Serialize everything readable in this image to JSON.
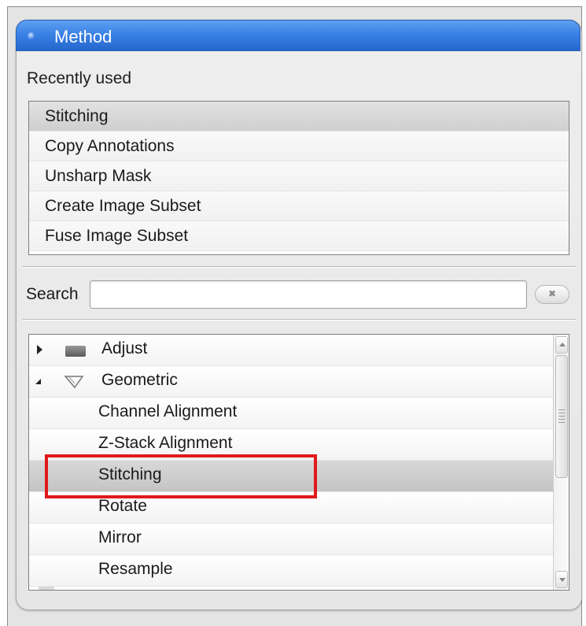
{
  "panel": {
    "title": "Method"
  },
  "recently_used": {
    "label": "Recently used",
    "items": [
      {
        "label": "Stitching",
        "selected": true
      },
      {
        "label": "Copy Annotations"
      },
      {
        "label": "Unsharp Mask"
      },
      {
        "label": "Create Image Subset"
      },
      {
        "label": "Fuse Image Subset"
      }
    ]
  },
  "search": {
    "label": "Search",
    "value": "",
    "placeholder": ""
  },
  "tree": {
    "categories": [
      {
        "label": "Adjust",
        "expanded": false,
        "icon": "folder-icon"
      },
      {
        "label": "Geometric",
        "expanded": true,
        "icon": "geometric-icon"
      }
    ],
    "items": [
      {
        "label": "Channel Alignment"
      },
      {
        "label": "Z-Stack Alignment"
      },
      {
        "label": "Stitching",
        "selected": true
      },
      {
        "label": "Rotate"
      },
      {
        "label": "Mirror"
      },
      {
        "label": "Resample"
      }
    ]
  },
  "colors": {
    "header_blue": "#3b82e6",
    "highlight_red": "#e0191c",
    "selection_gray": "#cfcfcf"
  }
}
